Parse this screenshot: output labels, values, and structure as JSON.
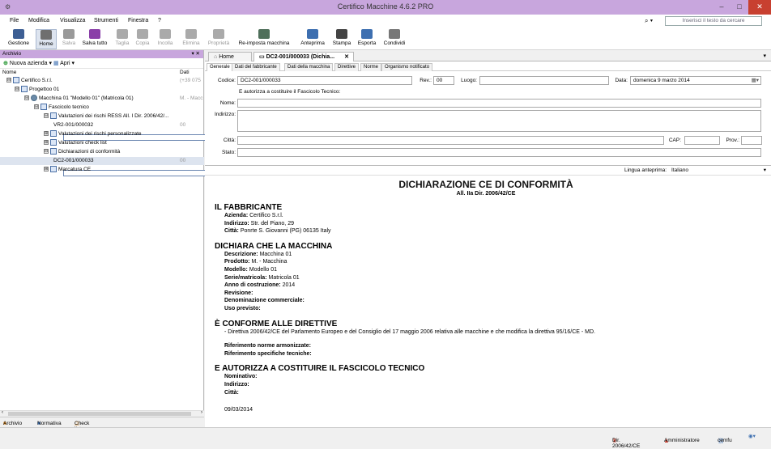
{
  "window": {
    "title": "Certifico Macchine 4.6.2 PRO",
    "minimize": "–",
    "maximize": "□",
    "close": "✕"
  },
  "menu": [
    "File",
    "Modifica",
    "Visualizza",
    "Strumenti",
    "Finestra",
    "?"
  ],
  "search": {
    "placeholder": "Inserisci il testo da cercare",
    "icon_label": "⌕ ▾"
  },
  "toolbar": [
    {
      "label": "Gestione",
      "icon": "grid-icon",
      "color": "#3d5f94",
      "enabled": true
    },
    {
      "label": "Home",
      "icon": "home-icon",
      "color": "#6f6f6f",
      "enabled": true,
      "selected": true
    },
    {
      "label": "Salva",
      "icon": "save-icon",
      "color": "#9a9a9a",
      "enabled": false
    },
    {
      "label": "Salva tutto",
      "icon": "save-all-icon",
      "color": "#8a3fa8",
      "enabled": true
    },
    {
      "label": "Taglia",
      "icon": "cut-icon",
      "color": "#aaaaaa",
      "enabled": false
    },
    {
      "label": "Copia",
      "icon": "copy-icon",
      "color": "#aaaaaa",
      "enabled": false
    },
    {
      "label": "Incolla",
      "icon": "paste-icon",
      "color": "#aaaaaa",
      "enabled": false
    },
    {
      "label": "Elimina",
      "icon": "delete-icon",
      "color": "#aaaaaa",
      "enabled": false
    },
    {
      "label": "Proprietà",
      "icon": "properties-icon",
      "color": "#aaaaaa",
      "enabled": false
    },
    {
      "label": "Re-imposta macchina",
      "icon": "gear-icon",
      "color": "#4f6f5a",
      "enabled": true
    },
    {
      "label": "Anteprima",
      "icon": "preview-icon",
      "color": "#3d6fb0",
      "enabled": true
    },
    {
      "label": "Stampa",
      "icon": "print-icon",
      "color": "#444444",
      "enabled": true
    },
    {
      "label": "Esporta",
      "icon": "export-icon",
      "color": "#3d6fb0",
      "enabled": true
    },
    {
      "label": "Condividi",
      "icon": "mail-icon",
      "color": "#777777",
      "enabled": true
    }
  ],
  "archive": {
    "title": "Archivio",
    "controls": "▾ ✕",
    "new_company": "Nuova azienda",
    "open": "Apri",
    "col_name": "Nome",
    "col_data": "Dati",
    "tree": [
      {
        "label": "Certifico S.r.l.",
        "value": "(+39 075",
        "expander": "⊟",
        "icon": "company-icon"
      },
      {
        "label": "Progettoo 01",
        "value": "",
        "expander": "⊟",
        "icon": "project-icon"
      },
      {
        "label": "Macchina 01 \"Modello 01\" (Matricola 01)",
        "value": "M. - Macc",
        "expander": "⊟",
        "icon": "machine-icon"
      },
      {
        "label": "Fascicolo tecnico",
        "value": "",
        "expander": "⊟",
        "icon": "folder-icon"
      },
      {
        "label": "Valutazioni dei rischi RESS All. I Dir. 2006/42/...",
        "value": "",
        "expander": "⊟",
        "icon": "folder-icon"
      },
      {
        "label": "VR2-001/000032",
        "value": "00",
        "expander": "",
        "icon": "document-icon"
      },
      {
        "label": "Valutazioni dei rischi personalizzate",
        "value": "",
        "expander": "⊞",
        "icon": "folder-icon"
      },
      {
        "label": "Valutazioni check list",
        "value": "",
        "expander": "⊞",
        "icon": "folder-icon"
      },
      {
        "label": "Dichiarazioni di conformità",
        "value": "",
        "expander": "⊟",
        "icon": "folder-icon"
      },
      {
        "label": "DC2-001/000033",
        "value": "00",
        "expander": "",
        "icon": "document-icon",
        "selected": true
      },
      {
        "label": "Marcatura CE",
        "value": "",
        "expander": "⊞",
        "icon": "folder-icon"
      }
    ],
    "bottom_tabs": [
      "Archivio",
      "Normativa",
      "Check list"
    ]
  },
  "doc_tabs": [
    {
      "label": "Home",
      "close": ""
    },
    {
      "label": "DC2-001/000033 (Dichia...",
      "close": "✕"
    }
  ],
  "doc_tab_overflow": "▾",
  "sub_tabs": [
    "Generale",
    "Dati del fabbricante",
    "Dati della macchina",
    "Direttive",
    "Norme",
    "Organismo notificato"
  ],
  "form": {
    "codice_label": "Codice:",
    "codice": "DC2-001/000033",
    "rev_label": "Rev.:",
    "rev": "00",
    "luogo_label": "Luogo:",
    "luogo": "",
    "data_label": "Data:",
    "data": "domenica  9   marzo   2014",
    "data_btn": "▦▾",
    "authorize_text": "E autorizza a costituire il Fascicolo Tecnico:",
    "nome_label": "Nome:",
    "nome": "",
    "indirizzo_label": "Indirizzo:",
    "indirizzo": "",
    "citta_label": "Città:",
    "citta": "",
    "cap_label": "CAP:",
    "cap": "",
    "prov_label": "Prov.:",
    "prov": "",
    "stato_label": "Stato:",
    "stato": ""
  },
  "preview": {
    "lang_label": "Lingua anteprima:",
    "lang": "Italiano",
    "title": "DICHIARAZIONE CE DI CONFORMITÀ",
    "subtitle": "All. IIa Dir. 2006/42/CE",
    "s1": "IL FABBRICANTE",
    "s1_lines": [
      {
        "k": "Azienda:",
        "v": "Certifico S.r.l."
      },
      {
        "k": "Indirizzo:",
        "v": "Str. del Piano, 29"
      },
      {
        "k": "Città:",
        "v": "Ponrte S. Giovanni (PG) 06135 Italy"
      }
    ],
    "s2": "DICHIARA CHE LA MACCHINA",
    "s2_lines": [
      {
        "k": "Descrizione:",
        "v": "Macchina 01"
      },
      {
        "k": "Prodotto:",
        "v": "M. - Macchina"
      },
      {
        "k": "Modello:",
        "v": "Modello 01"
      },
      {
        "k": "Serie/matricola:",
        "v": "Matricola 01"
      },
      {
        "k": "Anno di costruzione:",
        "v": "2014"
      },
      {
        "k": "Revisione:",
        "v": ""
      },
      {
        "k": "Denominazione commerciale:",
        "v": ""
      },
      {
        "k": "Uso previsto:",
        "v": ""
      }
    ],
    "s3": "È CONFORME ALLE DIRETTIVE",
    "s3_directive": "- Direttiva 2006/42/CE del Parlamento Europeo e del Consiglio del 17 maggio 2006 relativa alle macchine e che modifica la direttiva 95/16/CE - MD.",
    "s3_lines": [
      {
        "k": "Riferimento norme armonizzate:",
        "v": ""
      },
      {
        "k": "Riferimento specifiche tecniche:",
        "v": ""
      }
    ],
    "s4": "E AUTORIZZA A COSTITUIRE IL FASCICOLO TECNICO",
    "s4_lines": [
      {
        "k": "Nominativo:",
        "v": ""
      },
      {
        "k": "Indirizzo:",
        "v": ""
      },
      {
        "k": "Città:",
        "v": ""
      }
    ],
    "date": "09/03/2014"
  },
  "status": {
    "directive": "Dir. 2006/42/CE",
    "user_role": "Amministratore",
    "user": "cemfu"
  }
}
